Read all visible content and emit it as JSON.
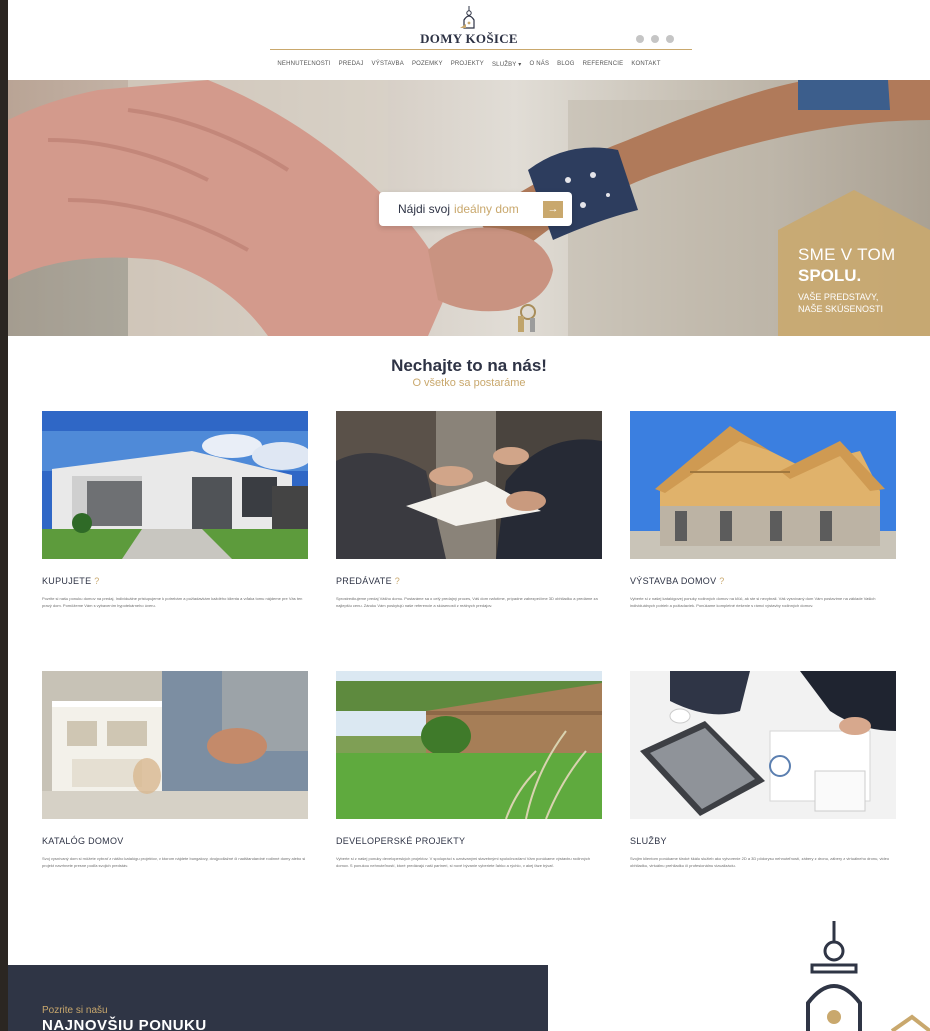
{
  "brand": {
    "name": "DOMY KOŠICE"
  },
  "colors": {
    "gold": "#c9a86d",
    "navy": "#2f3545",
    "text": "#2e3345"
  },
  "social": [
    "mail-icon",
    "facebook-icon",
    "instagram-icon"
  ],
  "nav": [
    "NEHNUTEĽNOSTI",
    "PREDAJ",
    "VÝSTAVBA",
    "POZEMKY",
    "PROJEKTY",
    "SLUŽBY ▾",
    "O NÁS",
    "BLOG",
    "REFERENCIE",
    "KONTAKT"
  ],
  "hero": {
    "search_prefix": "Nájdi svoj",
    "search_accent": "ideálny dom",
    "search_button": "→",
    "badge_line1": "SME V TOM",
    "badge_line2": "SPOLU.",
    "badge_line3": "VAŠE PREDSTAVY,",
    "badge_line4": "NAŠE SKÚSENOSTI"
  },
  "section": {
    "title": "Nechajte to na nás!",
    "subtitle": "O všetko sa postaráme"
  },
  "cards": [
    {
      "title": "KUPUJETE",
      "q": "?",
      "text": "Pozrite si našu ponuku domov na predaj. Individuálne pristupujeme k potrebám a požiadavkám každého klienta a vďaka tomu nájdeme pre Vás ten pravý dom. Pomôžeme Vám s vybavením hypotekárneho úveru."
    },
    {
      "title": "PREDÁVATE",
      "q": "?",
      "text": "Sprostredkujeme predaj Vášho domu. Postaráme sa o celý predajný proces, Váš dom nafotíme, prípadne zabezpečíme 3D obhliadku a predáme za najlepšiu cenu. Záruku Vám poskytujú naše referencie a skúsenosti z reálnych predajov."
    },
    {
      "title": "VÝSTAVBA DOMOV",
      "q": "?",
      "text": "Vyberte si z našej katalógovej ponuky rodinných domov na kľúč, ak ste si nevybrali. Váš vysnívaný dom Vám postavíme na základe Vašich individuálnych potrieb a požiadaviek. Ponúkame kompletné riešenie s rámci výstavby rodinných domov."
    },
    {
      "title": "KATALÓG DOMOV",
      "q": "",
      "text": "Svoj vysnívaný dom si môžete vybrať z nášho katalógu projektov, v ktorom nájdete bungalovy, dvojpodlažné či nadštandardné rodinné domy alebo si projekt navrhnete presne podľa svojich predstáv."
    },
    {
      "title": "DEVELOPERSKÉ PROJEKTY",
      "q": "",
      "text": "Vyberte si z našej ponuky developerských projektov. V spolupráci s uznávanými stavebnými spoločnosťami Vám ponúkame výstavbu rodinných domov. S ponukou nehnuteľností, ktoré predávajú naši partneri, si nové bývanie vyberiete ľahko a rýchlo, v akej fáze bývať."
    },
    {
      "title": "SLUŽBY",
      "q": "",
      "text": "Svojim klientom ponúkame široké škálu služieb ako vytvorenie 2D a 3D pôdorysu nehnuteľností, zábery z dronu, zábery z virtuálneho dronu, video obhliadku, virtuálnu prehliadku či profesionálnu vizualizáciu."
    }
  ],
  "bottom": {
    "small": "Pozrite si našu",
    "big": "NAJNOVŠIU PONUKU"
  }
}
